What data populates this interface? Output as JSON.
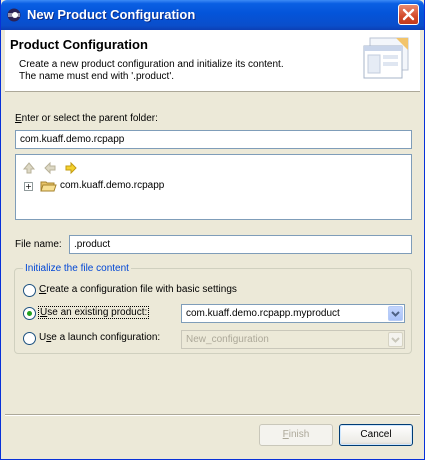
{
  "window": {
    "title": "New Product Configuration"
  },
  "banner": {
    "heading": "Product Configuration",
    "description_line1": "Create a new product configuration and initialize its content.",
    "description_line2": "The name must end with '.product'."
  },
  "parent_folder": {
    "label_mnemonic": "E",
    "label_rest": "nter or select the parent folder:",
    "value": "com.kuaff.demo.rcpapp",
    "tree": {
      "items": [
        {
          "label": "com.kuaff.demo.rcpapp",
          "expanded": false
        }
      ]
    }
  },
  "file_name": {
    "label": "File name:",
    "value": ".product"
  },
  "init_group": {
    "title": "Initialize the file content",
    "options": [
      {
        "mnemonic": "C",
        "rest": "reate a configuration file with basic settings",
        "selected": false
      },
      {
        "mnemonic": "U",
        "rest": "se an existing product:",
        "selected": true,
        "combo_value": "com.kuaff.demo.rcpapp.myproduct"
      },
      {
        "prefix": "U",
        "mnemonic": "s",
        "rest": "e a launch configuration:",
        "selected": false,
        "combo_value": "New_configuration"
      }
    ]
  },
  "buttons": {
    "finish_mnemonic": "F",
    "finish_rest": "inish",
    "cancel": "Cancel"
  },
  "colors": {
    "titlebar": "#0454d9",
    "dialog_bg": "#ece9d8",
    "group_title": "#0046d5",
    "radio_dot": "#21a121"
  },
  "icons": [
    "eclipse-app-icon",
    "close-icon",
    "wizard-banner-icon",
    "nav-up-icon",
    "nav-back-icon",
    "nav-forward-icon",
    "folder-open-icon",
    "dropdown-arrow-icon"
  ]
}
